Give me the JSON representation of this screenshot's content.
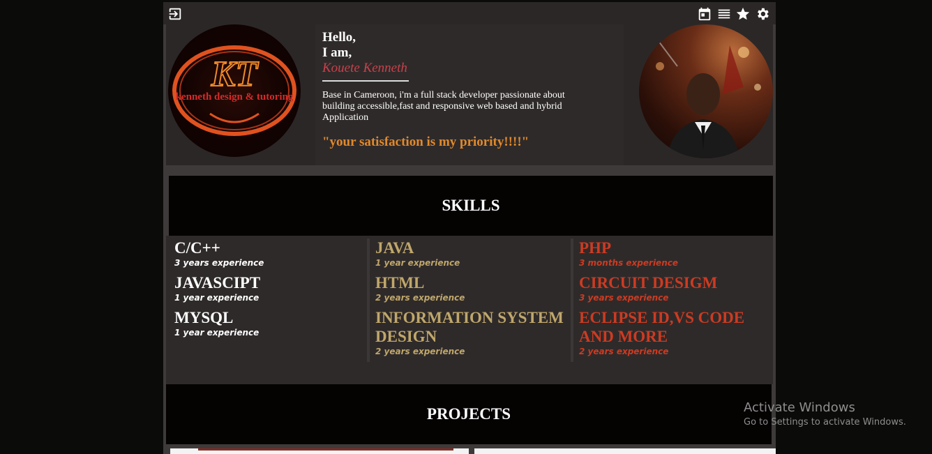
{
  "toolbar": {
    "icons": [
      "exit-icon",
      "calendar-icon",
      "list-icon",
      "star-icon",
      "gear-icon"
    ]
  },
  "hero": {
    "greeting_line1": "Hello,",
    "greeting_line2": "I am,",
    "name": "Kouete Kenneth",
    "bio": "Base in Cameroon, i'm a full stack developer passionate about building accessible,fast and responsive web based and hybrid Application",
    "quote": "\"your satisfaction is my priority!!!!\"",
    "logo": {
      "monogram": "KT",
      "tagline": "kenneth design & tutoring"
    }
  },
  "skills": {
    "title": "SKILLS",
    "columns": [
      {
        "color": "#ffffff",
        "items": [
          {
            "name": "C/C++",
            "experience": "3 years experience"
          },
          {
            "name": "JAVASCIPT",
            "experience": "1 year experience"
          },
          {
            "name": "MYSQL",
            "experience": "1 year experience"
          }
        ]
      },
      {
        "color": "#bfa76b",
        "items": [
          {
            "name": "JAVA",
            "experience": "1 year experience"
          },
          {
            "name": "HTML",
            "experience": "2 years experience"
          },
          {
            "name": "INFORMATION SYSTEM DESIGN",
            "experience": "2 years experience"
          }
        ]
      },
      {
        "color": "#cc3b22",
        "items": [
          {
            "name": "PHP",
            "experience": "3 months experience"
          },
          {
            "name": "CIRCUIT DESIGM",
            "experience": "3 years experience"
          },
          {
            "name": "ECLIPSE ID,VS CODE AND MORE",
            "experience": "2 years experience"
          }
        ]
      }
    ]
  },
  "projects": {
    "title": "PROJECTS"
  },
  "watermark": {
    "title": "Activate Windows",
    "subtitle": "Go to Settings to activate Windows."
  }
}
